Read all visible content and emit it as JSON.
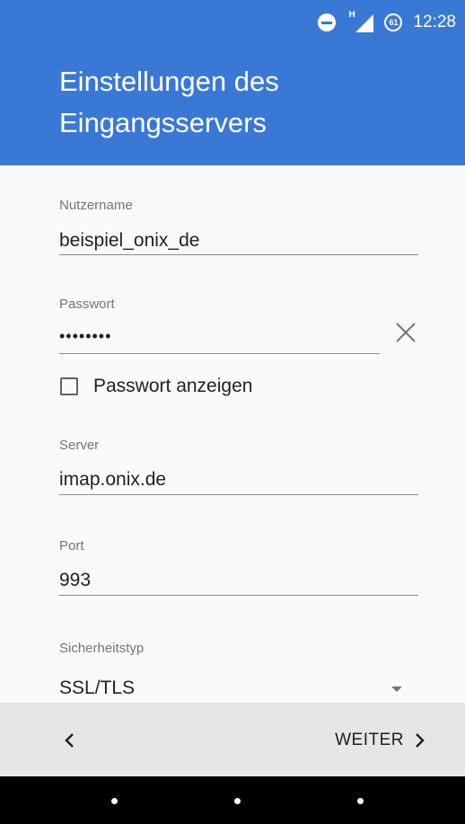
{
  "status_bar": {
    "time": "12:28",
    "network_letter": "H",
    "battery_level": "61",
    "icons": [
      "do-not-disturb-icon",
      "signal-icon",
      "battery-icon"
    ]
  },
  "header": {
    "title_line1": "Einstellungen des",
    "title_line2": "Eingangsservers",
    "color": "#3a78d6"
  },
  "form": {
    "username": {
      "label": "Nutzername",
      "value": "beispiel_onix_de"
    },
    "password": {
      "label": "Passwort",
      "value": "••••••••"
    },
    "show_password": {
      "label": "Passwort anzeigen",
      "checked": false
    },
    "server": {
      "label": "Server",
      "value": "imap.onix.de"
    },
    "port": {
      "label": "Port",
      "value": "993"
    },
    "security_type": {
      "label": "Sicherheitstyp",
      "value": "SSL/TLS"
    }
  },
  "bottom_bar": {
    "next_label": "WEITER"
  }
}
